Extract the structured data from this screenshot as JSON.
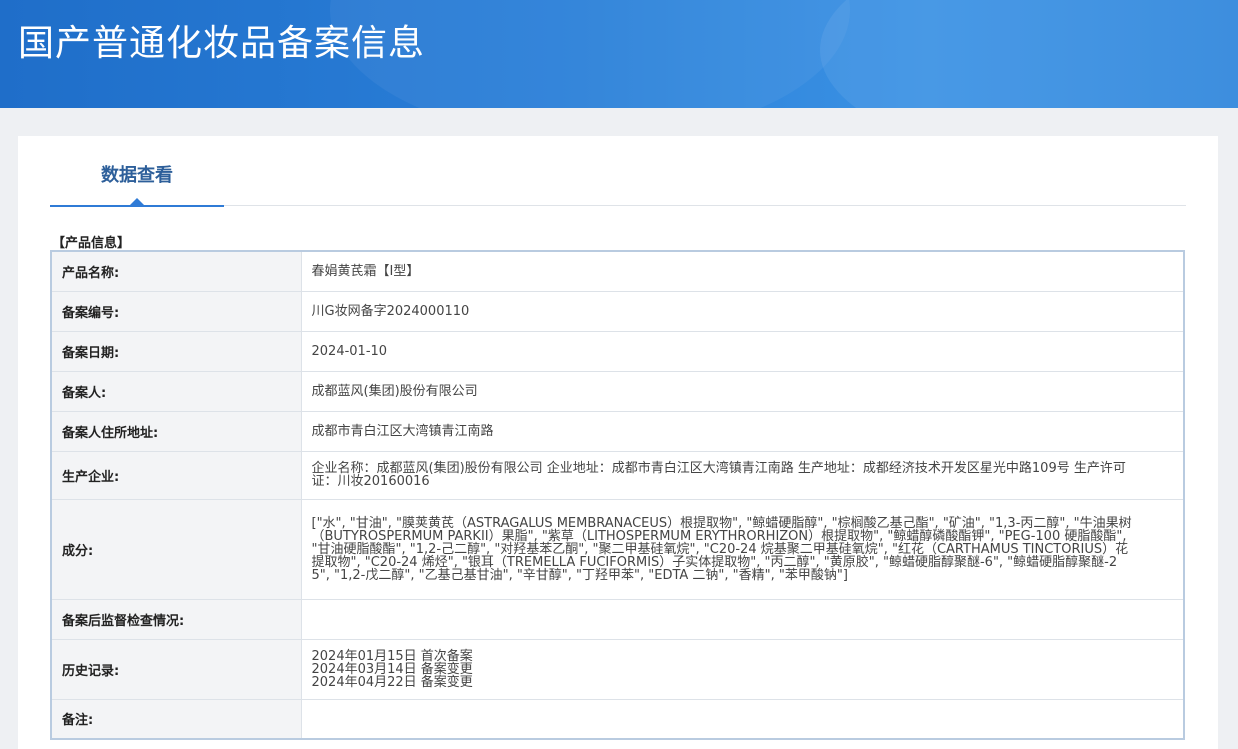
{
  "header": {
    "title": "国产普通化妆品备案信息"
  },
  "tabs": [
    {
      "label": "数据查看"
    }
  ],
  "section": {
    "title": "【产品信息】"
  },
  "rows": [
    {
      "label": "产品名称:",
      "value": "春娟黄芪霜【Ⅰ型】"
    },
    {
      "label": "备案编号:",
      "value": "川G妆网备字2024000110"
    },
    {
      "label": "备案日期:",
      "value": "2024-01-10"
    },
    {
      "label": "备案人:",
      "value": "成都蓝风(集团)股份有限公司"
    },
    {
      "label": "备案人住所地址:",
      "value": "成都市青白江区大湾镇青江南路"
    },
    {
      "label": "生产企业:",
      "value": "企业名称：成都蓝风(集团)股份有限公司 企业地址：成都市青白江区大湾镇青江南路 生产地址：成都经济技术开发区星光中路109号 生产许可证：川妆20160016"
    },
    {
      "label": "成分:",
      "value": "[\"水\", \"甘油\", \"膜荚黄芪（ASTRAGALUS MEMBRANACEUS）根提取物\", \"鲸蜡硬脂醇\", \"棕榈酸乙基己酯\", \"矿油\", \"1,3-丙二醇\", \"牛油果树（BUTYROSPERMUM PARKII）果脂\", \"紫草（LITHOSPERMUM ERYTHRORHIZON）根提取物\", \"鲸蜡醇磷酸酯钾\", \"PEG-100 硬脂酸酯\", \"甘油硬脂酸酯\", \"1,2-己二醇\", \"对羟基苯乙酮\", \"聚二甲基硅氧烷\", \"C20-24 烷基聚二甲基硅氧烷\", \"红花（CARTHAMUS TINCTORIUS）花提取物\", \"C20-24 烯烃\", \"银耳（TREMELLA FUCIFORMIS）子实体提取物\", \"丙二醇\", \"黄原胶\", \"鲸蜡硬脂醇聚醚-6\", \"鲸蜡硬脂醇聚醚-25\", \"1,2-戊二醇\", \"乙基己基甘油\", \"辛甘醇\", \"丁羟甲苯\", \"EDTA 二钠\", \"香精\", \"苯甲酸钠\"]"
    },
    {
      "label": "备案后监督检查情况:",
      "value": ""
    },
    {
      "label": "历史记录:",
      "history": [
        "2024年01月15日 首次备案",
        "2024年03月14日 备案变更",
        "2024年04月22日 备案变更"
      ]
    },
    {
      "label": "备注:",
      "value": ""
    }
  ]
}
